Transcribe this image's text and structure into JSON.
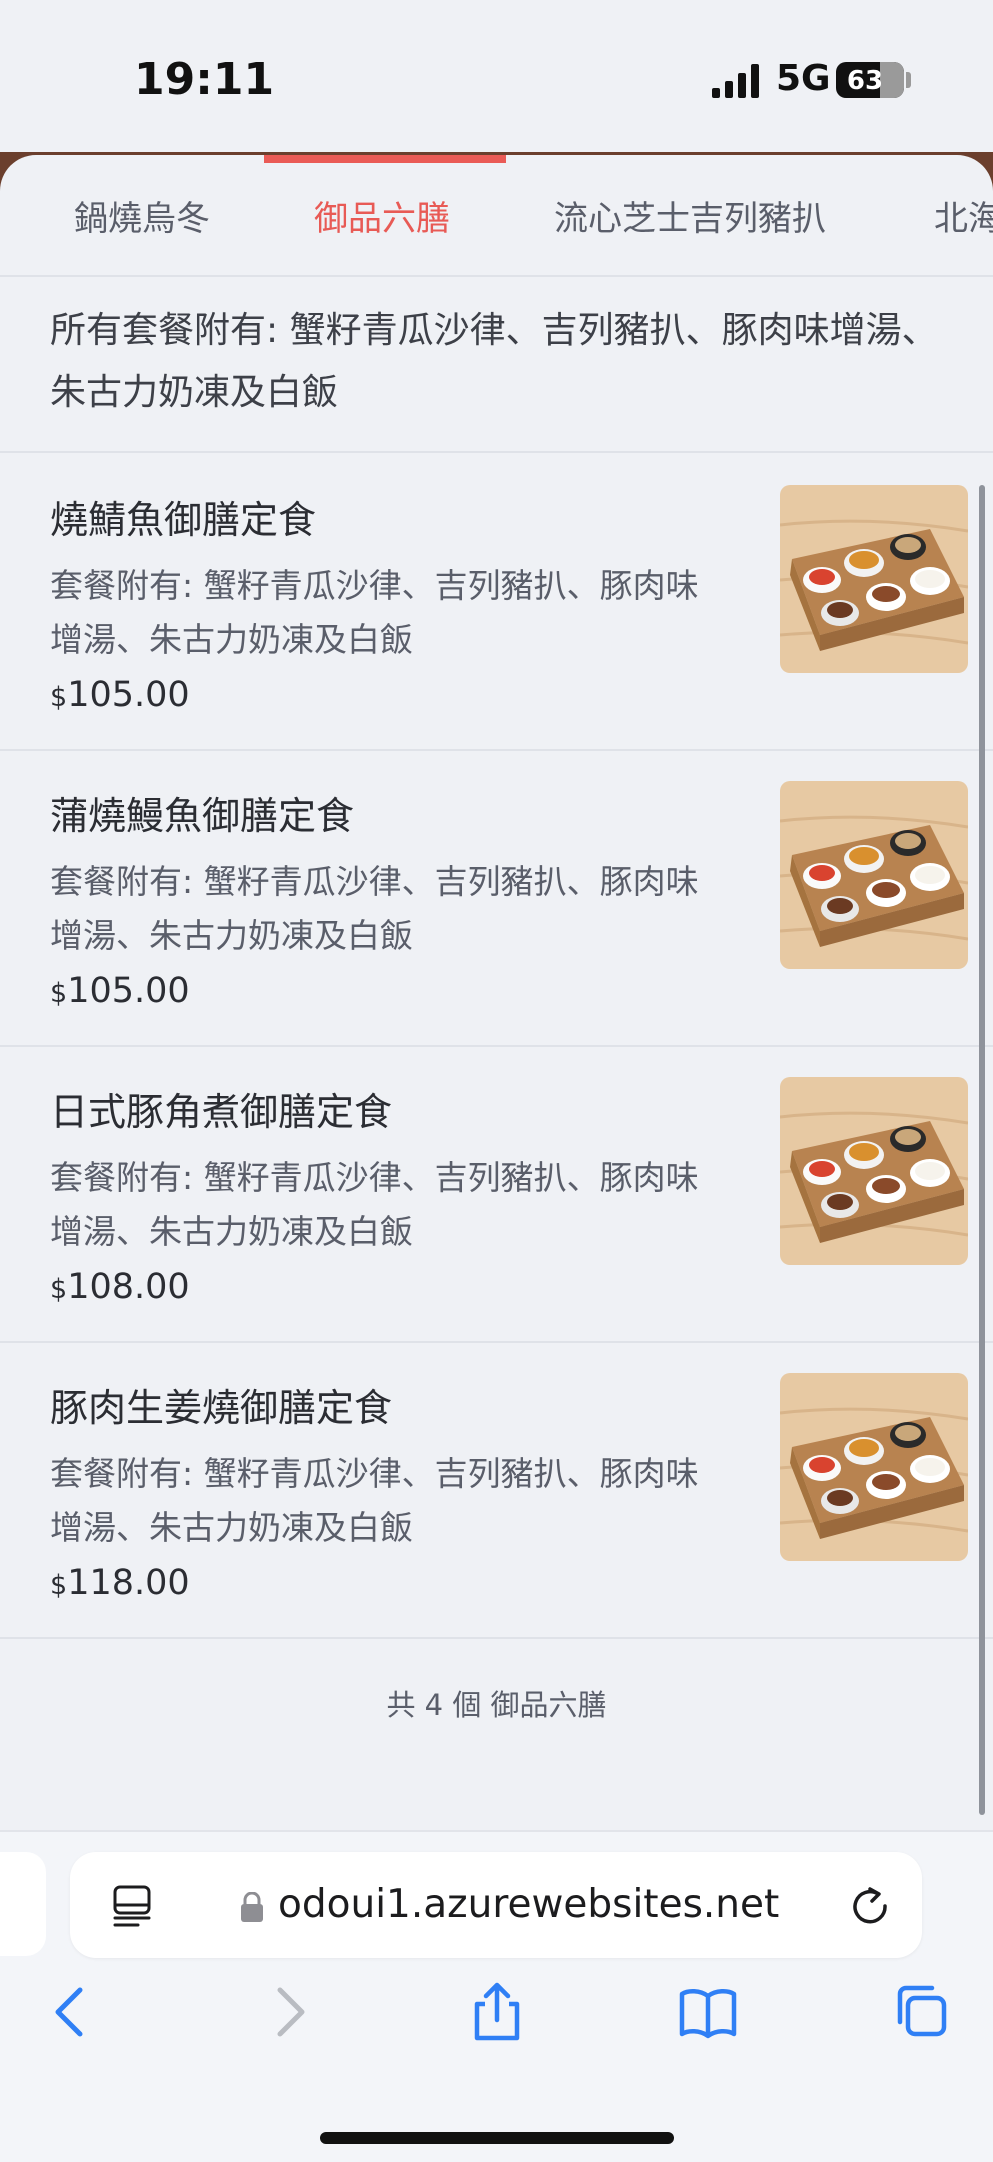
{
  "status": {
    "time": "19:11",
    "network": "5G",
    "battery": "63"
  },
  "tabs": [
    {
      "label": "鍋燒烏冬"
    },
    {
      "label": "御品六膳"
    },
    {
      "label": "流心芝士吉列豬扒"
    },
    {
      "label": "北海"
    }
  ],
  "active_tab": "御品六膳",
  "category_note": "所有套餐附有: 蟹籽青瓜沙律、吉列豬扒、豚肉味增湯、朱古力奶凍及白飯",
  "currency_symbol": "$",
  "items": [
    {
      "name": "燒鯖魚御膳定食",
      "desc": "套餐附有: 蟹籽青瓜沙律、吉列豬扒、豚肉味增湯、朱古力奶凍及白飯",
      "price": "105.00"
    },
    {
      "name": "蒲燒鰻魚御膳定食",
      "desc": "套餐附有: 蟹籽青瓜沙律、吉列豬扒、豚肉味增湯、朱古力奶凍及白飯",
      "price": "105.00"
    },
    {
      "name": "日式豚角煮御膳定食",
      "desc": "套餐附有: 蟹籽青瓜沙律、吉列豬扒、豚肉味增湯、朱古力奶凍及白飯",
      "price": "108.00"
    },
    {
      "name": "豚肉生姜燒御膳定食",
      "desc": "套餐附有: 蟹籽青瓜沙律、吉列豬扒、豚肉味增湯、朱古力奶凍及白飯",
      "price": "118.00"
    }
  ],
  "footer": {
    "count_text": "共 4 個 御品六膳"
  },
  "browser": {
    "url": "odoui1.azurewebsites.net"
  },
  "icons": {
    "reader": "reader-mode-icon",
    "lock": "lock-icon",
    "reload": "reload-icon",
    "back": "back-icon",
    "forward": "forward-icon",
    "share": "share-icon",
    "bookmarks": "bookmarks-icon",
    "tabs": "tabs-icon"
  },
  "colors": {
    "accent": "#ea5b56",
    "link_blue": "#2f7ff5",
    "background": "#eff1f5"
  }
}
